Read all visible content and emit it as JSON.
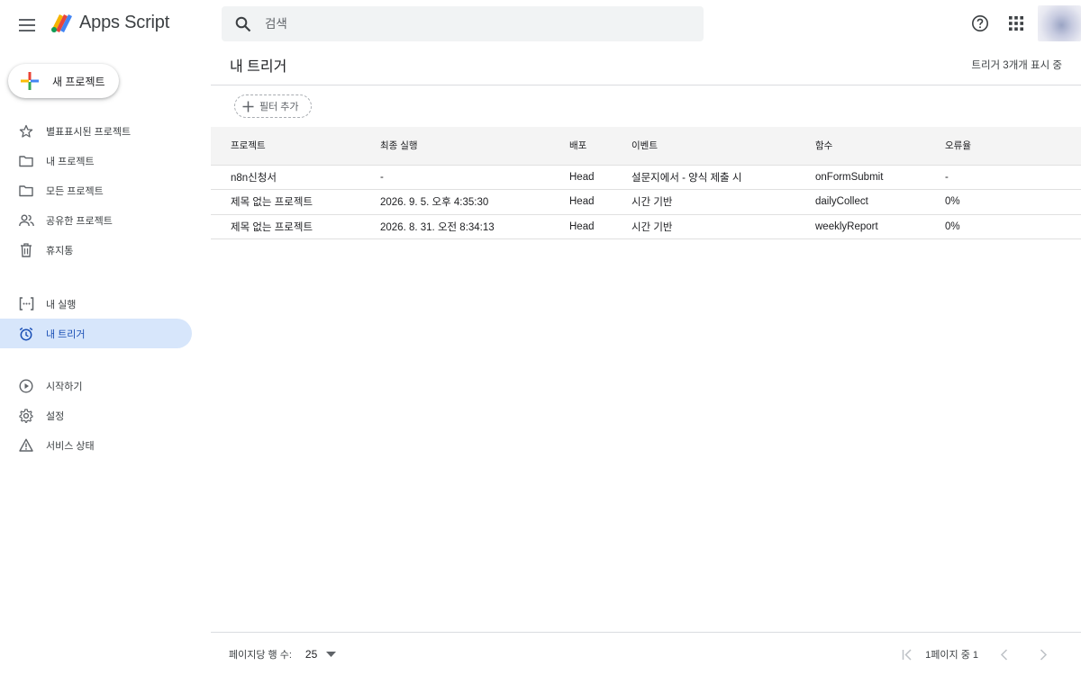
{
  "app": {
    "name": "Apps Script"
  },
  "search": {
    "placeholder": "검색"
  },
  "sidebar": {
    "new_project": "새 프로젝트",
    "items": [
      {
        "label": "별표표시된 프로젝트",
        "icon": "star-icon"
      },
      {
        "label": "내 프로젝트",
        "icon": "folder-icon"
      },
      {
        "label": "모든 프로젝트",
        "icon": "folder-icon"
      },
      {
        "label": "공유한 프로젝트",
        "icon": "people-icon"
      },
      {
        "label": "휴지통",
        "icon": "trash-icon"
      },
      {
        "label": "내 실행",
        "icon": "executions-icon"
      },
      {
        "label": "내 트리거",
        "icon": "alarm-icon",
        "active": true
      },
      {
        "label": "시작하기",
        "icon": "play-circle-icon"
      },
      {
        "label": "설정",
        "icon": "gear-icon"
      },
      {
        "label": "서비스 상태",
        "icon": "warning-icon"
      }
    ]
  },
  "main": {
    "title": "내 트리거",
    "count": "트리거 3개개 표시 중",
    "filter": "필터 추가",
    "columns": [
      "프로젝트",
      "최종 실행",
      "배포",
      "이벤트",
      "함수",
      "오류율"
    ],
    "rows": [
      [
        "n8n신청서",
        "-",
        "Head",
        "설문지에서 - 양식 제출 시",
        "onFormSubmit",
        "-"
      ],
      [
        "제목 없는 프로젝트",
        "2026. 9. 5. 오후 4:35:30",
        "Head",
        "시간 기반",
        "dailyCollect",
        "0%"
      ],
      [
        "제목 없는 프로젝트",
        "2026. 8. 31. 오전 8:34:13",
        "Head",
        "시간 기반",
        "weeklyReport",
        "0%"
      ]
    ]
  },
  "footer": {
    "rows_per_page_label": "페이지당 행 수:",
    "rows_per_page": "25",
    "page_text": "1페이지 중 1"
  },
  "colors": {
    "active_bg": "#d7e6fb",
    "active_text": "#1a4fb5",
    "header_bg": "#f4f4f4"
  }
}
